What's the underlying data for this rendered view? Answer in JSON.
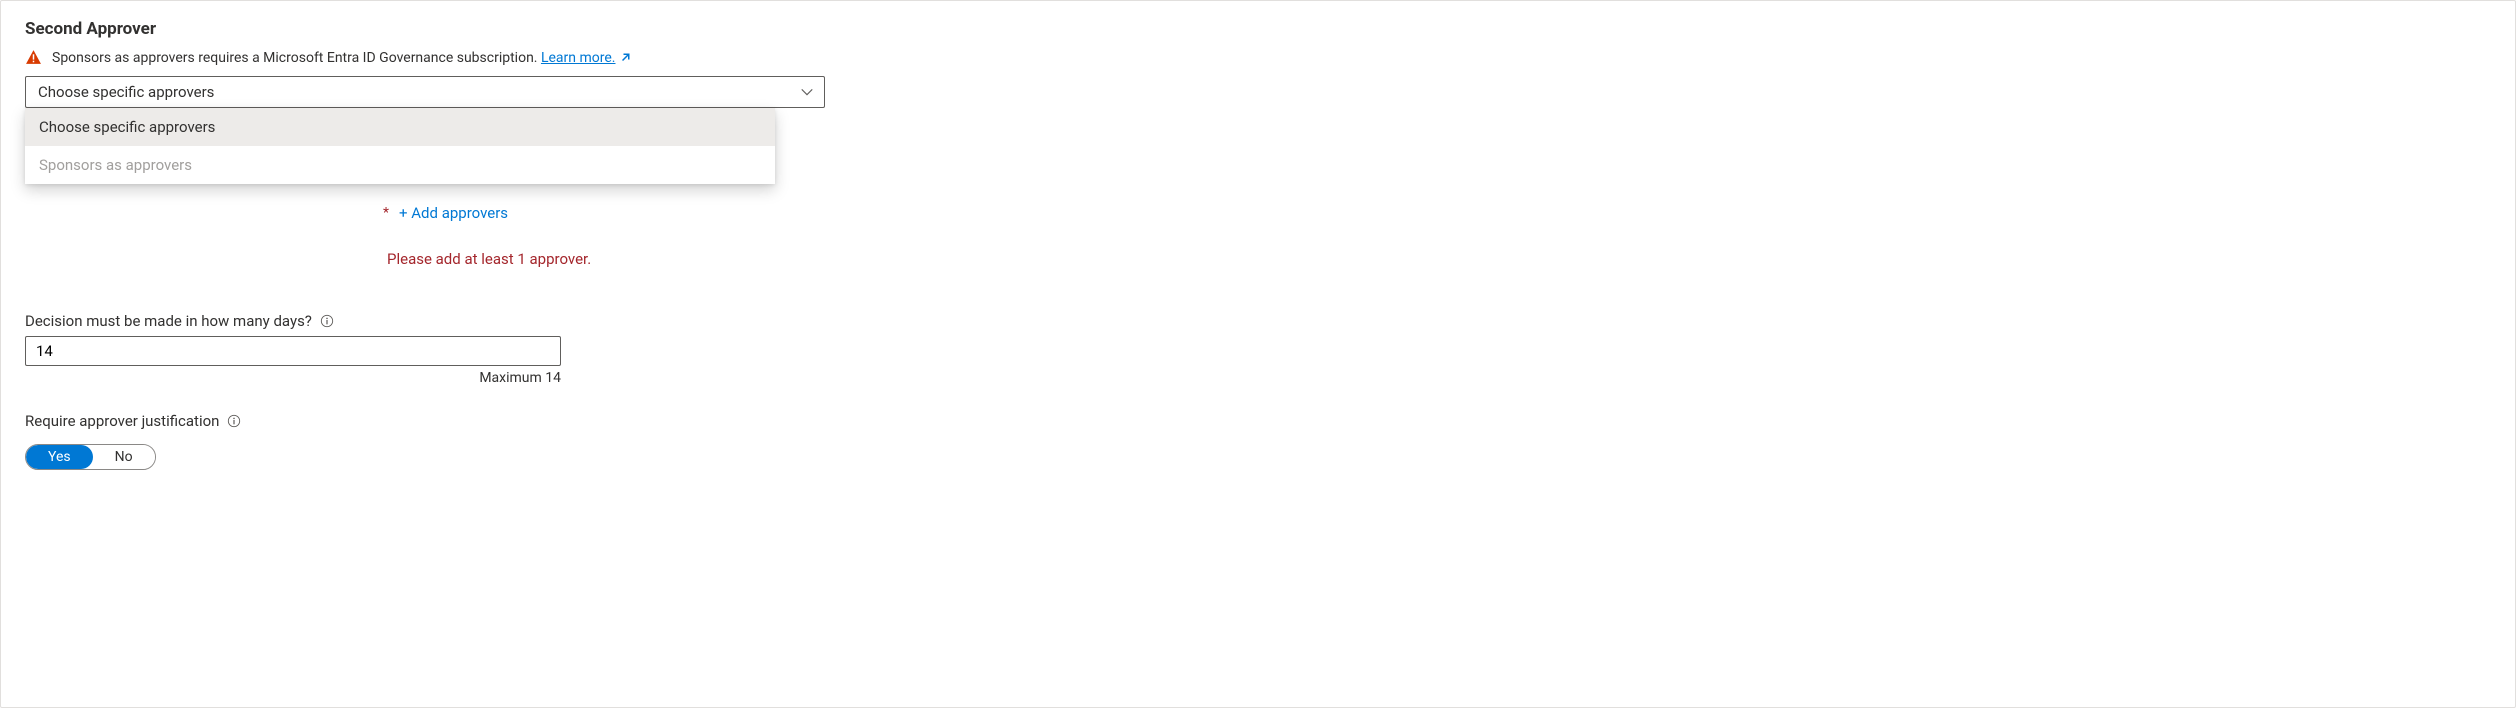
{
  "section": {
    "title": "Second Approver"
  },
  "warning": {
    "text": "Sponsors as approvers requires a Microsoft Entra ID Governance subscription. ",
    "link_label": "Learn more."
  },
  "dropdown": {
    "selected": "Choose specific approvers",
    "options": [
      {
        "label": "Choose specific approvers",
        "selected": true,
        "disabled": false
      },
      {
        "label": "Sponsors as approvers",
        "selected": false,
        "disabled": true
      }
    ]
  },
  "add_approvers": {
    "label": "+ Add approvers",
    "required_marker": "*"
  },
  "validation": {
    "message": "Please add at least 1 approver."
  },
  "decision_days": {
    "label": "Decision must be made in how many days?",
    "value": "14",
    "helper": "Maximum 14"
  },
  "justification": {
    "label": "Require approver justification",
    "yes": "Yes",
    "no": "No",
    "value": "Yes"
  }
}
